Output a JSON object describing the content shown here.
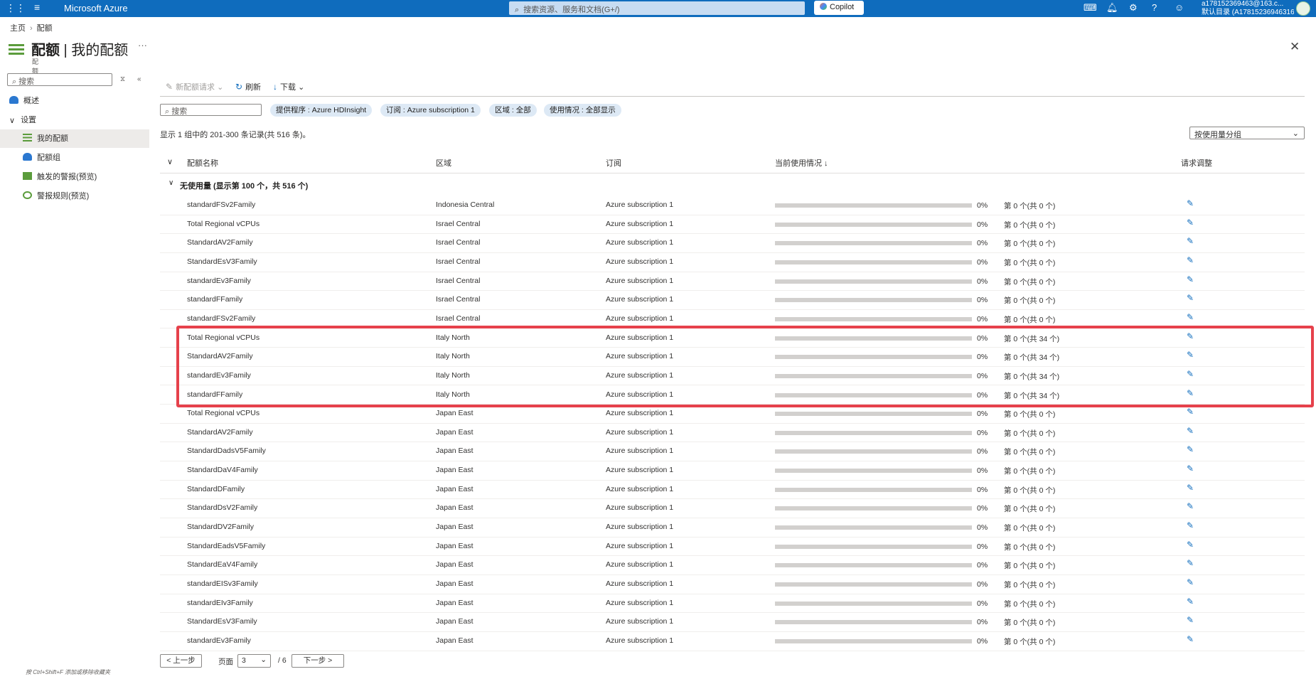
{
  "topbar": {
    "brand": "Microsoft Azure",
    "search_placeholder": "搜索资源、服务和文档(G+/)",
    "copilot_label": "Copilot",
    "account_line1": "a178152369463@163.c...",
    "account_line2": "默认目录 (A178152369463163...",
    "icons": [
      "waffle-icon",
      "hamburger-icon",
      "cloud-shell-icon",
      "bell-icon",
      "gear-icon",
      "help-icon",
      "feedback-icon"
    ]
  },
  "breadcrumb": [
    "主页",
    "配额"
  ],
  "header": {
    "title_bold": "配额",
    "title_rest": " | 我的配额",
    "subtitle": "配额",
    "more": "···"
  },
  "sidebar": {
    "search_placeholder": "搜索",
    "items": [
      {
        "label": "概述",
        "icon": "cloud-icon"
      },
      {
        "label": "设置",
        "icon": "chevron-down-icon"
      },
      {
        "label": "我的配额",
        "icon": "list-icon",
        "selected": true
      },
      {
        "label": "配额组",
        "icon": "cloud-group-icon"
      },
      {
        "label": "触发的警报(预览)",
        "icon": "alert-book-icon"
      },
      {
        "label": "警报规则(预览)",
        "icon": "alert-rule-icon"
      }
    ]
  },
  "toolbar": {
    "new_request": "新配额请求",
    "refresh": "刷新",
    "download": "下载"
  },
  "filters": {
    "search_placeholder": "搜索",
    "pills": [
      {
        "key": "提供程序 : ",
        "value": "Azure HDInsight"
      },
      {
        "key": "订阅 : ",
        "value": "Azure subscription 1"
      },
      {
        "key": "区域 : ",
        "value": "全部"
      },
      {
        "key": "使用情况 : ",
        "value": "全部显示"
      }
    ],
    "record_count": "显示 1 组中的 201-300 条记录(共 516 条)。",
    "groupby": "按使用量分组"
  },
  "table": {
    "headers": [
      "配额名称",
      "区域",
      "订阅",
      "当前使用情况 ↓",
      "请求调整"
    ],
    "group_label": "无使用量 (显示第 100 个，共 516 个)",
    "rows": [
      {
        "name": "standardFSv2Family",
        "region": "Indonesia Central",
        "sub": "Azure subscription 1",
        "pct": "0%",
        "usage": "第 0 个(共 0 个)"
      },
      {
        "name": "Total Regional vCPUs",
        "region": "Israel Central",
        "sub": "Azure subscription 1",
        "pct": "0%",
        "usage": "第 0 个(共 0 个)"
      },
      {
        "name": "StandardAV2Family",
        "region": "Israel Central",
        "sub": "Azure subscription 1",
        "pct": "0%",
        "usage": "第 0 个(共 0 个)"
      },
      {
        "name": "StandardEsV3Family",
        "region": "Israel Central",
        "sub": "Azure subscription 1",
        "pct": "0%",
        "usage": "第 0 个(共 0 个)"
      },
      {
        "name": "standardEv3Family",
        "region": "Israel Central",
        "sub": "Azure subscription 1",
        "pct": "0%",
        "usage": "第 0 个(共 0 个)"
      },
      {
        "name": "standardFFamily",
        "region": "Israel Central",
        "sub": "Azure subscription 1",
        "pct": "0%",
        "usage": "第 0 个(共 0 个)"
      },
      {
        "name": "standardFSv2Family",
        "region": "Israel Central",
        "sub": "Azure subscription 1",
        "pct": "0%",
        "usage": "第 0 个(共 0 个)"
      },
      {
        "name": "Total Regional vCPUs",
        "region": "Italy North",
        "sub": "Azure subscription 1",
        "pct": "0%",
        "usage": "第 0 个(共 34 个)"
      },
      {
        "name": "StandardAV2Family",
        "region": "Italy North",
        "sub": "Azure subscription 1",
        "pct": "0%",
        "usage": "第 0 个(共 34 个)"
      },
      {
        "name": "standardEv3Family",
        "region": "Italy North",
        "sub": "Azure subscription 1",
        "pct": "0%",
        "usage": "第 0 个(共 34 个)"
      },
      {
        "name": "standardFFamily",
        "region": "Italy North",
        "sub": "Azure subscription 1",
        "pct": "0%",
        "usage": "第 0 个(共 34 个)"
      },
      {
        "name": "Total Regional vCPUs",
        "region": "Japan East",
        "sub": "Azure subscription 1",
        "pct": "0%",
        "usage": "第 0 个(共 0 个)"
      },
      {
        "name": "StandardAV2Family",
        "region": "Japan East",
        "sub": "Azure subscription 1",
        "pct": "0%",
        "usage": "第 0 个(共 0 个)"
      },
      {
        "name": "StandardDadsV5Family",
        "region": "Japan East",
        "sub": "Azure subscription 1",
        "pct": "0%",
        "usage": "第 0 个(共 0 个)"
      },
      {
        "name": "StandardDaV4Family",
        "region": "Japan East",
        "sub": "Azure subscription 1",
        "pct": "0%",
        "usage": "第 0 个(共 0 个)"
      },
      {
        "name": "StandardDFamily",
        "region": "Japan East",
        "sub": "Azure subscription 1",
        "pct": "0%",
        "usage": "第 0 个(共 0 个)"
      },
      {
        "name": "StandardDsV2Family",
        "region": "Japan East",
        "sub": "Azure subscription 1",
        "pct": "0%",
        "usage": "第 0 个(共 0 个)"
      },
      {
        "name": "StandardDV2Family",
        "region": "Japan East",
        "sub": "Azure subscription 1",
        "pct": "0%",
        "usage": "第 0 个(共 0 个)"
      },
      {
        "name": "StandardEadsV5Family",
        "region": "Japan East",
        "sub": "Azure subscription 1",
        "pct": "0%",
        "usage": "第 0 个(共 0 个)"
      },
      {
        "name": "StandardEaV4Family",
        "region": "Japan East",
        "sub": "Azure subscription 1",
        "pct": "0%",
        "usage": "第 0 个(共 0 个)"
      },
      {
        "name": "standardEISv3Family",
        "region": "Japan East",
        "sub": "Azure subscription 1",
        "pct": "0%",
        "usage": "第 0 个(共 0 个)"
      },
      {
        "name": "standardEIv3Family",
        "region": "Japan East",
        "sub": "Azure subscription 1",
        "pct": "0%",
        "usage": "第 0 个(共 0 个)"
      },
      {
        "name": "StandardEsV3Family",
        "region": "Japan East",
        "sub": "Azure subscription 1",
        "pct": "0%",
        "usage": "第 0 个(共 0 个)"
      },
      {
        "name": "standardEv3Family",
        "region": "Japan East",
        "sub": "Azure subscription 1",
        "pct": "0%",
        "usage": "第 0 个(共 0 个)"
      }
    ]
  },
  "pager": {
    "prev": "< 上一步",
    "page_label": "页面",
    "current_page": "3",
    "total": "/ 6",
    "next": "下一步 >"
  },
  "hint": "按 Ctrl+Shift+F 添加或移除收藏夹",
  "colors": {
    "accent": "#0f6cbd",
    "highlight": "#e6414b",
    "nav_selected": "#edebe9"
  }
}
